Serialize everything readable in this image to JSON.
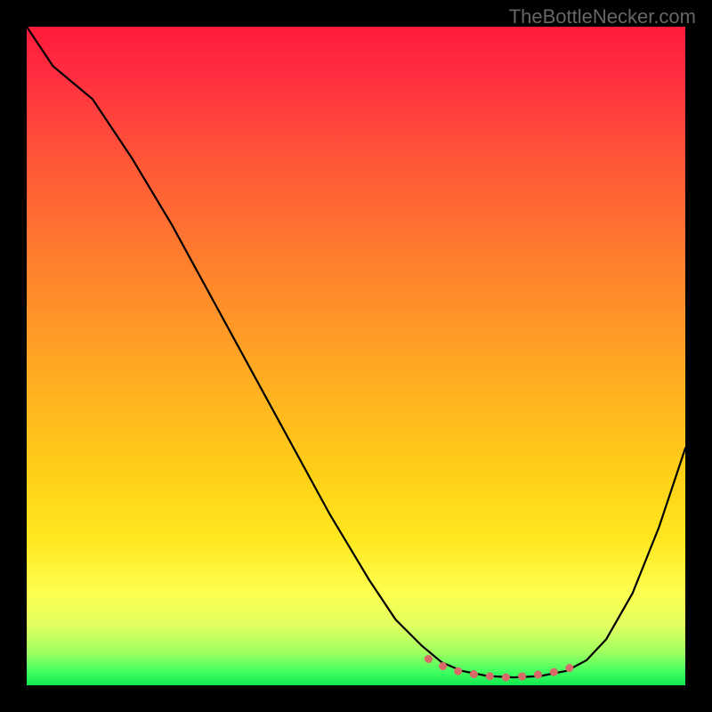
{
  "watermark": "TheBottleNecker.com",
  "colors": {
    "curve": "#000000",
    "dots": "#d86a6a",
    "background": "#000000"
  },
  "chart_data": {
    "type": "line",
    "title": "",
    "xlabel": "",
    "ylabel": "",
    "xlim": [
      0,
      100
    ],
    "ylim": [
      0,
      100
    ],
    "note": "No axes or tick labels are rendered in the source image. x and y are normalized 0–100. y represents percent-from-top (0 = top, 100 = bottom). Curve shape estimated from pixel positions.",
    "series": [
      {
        "name": "bottleneck-curve",
        "x": [
          0,
          4,
          10,
          16,
          22,
          28,
          34,
          40,
          46,
          52,
          56,
          60,
          63,
          66,
          70,
          74,
          78,
          82,
          85,
          88,
          92,
          96,
          100
        ],
        "y": [
          0,
          6,
          11,
          20,
          30,
          41,
          52,
          63,
          74,
          84,
          90,
          94,
          96.5,
          97.8,
          98.6,
          98.8,
          98.6,
          97.8,
          96.2,
          93,
          86,
          76,
          64
        ]
      }
    ],
    "valley_marker": {
      "name": "valley-dots",
      "note": "Coral dotted overlay across the valley floor",
      "x": [
        61,
        64,
        67,
        70,
        73,
        76,
        79,
        82,
        84
      ],
      "y": [
        96.0,
        97.5,
        98.2,
        98.6,
        98.8,
        98.6,
        98.2,
        97.6,
        96.5
      ]
    }
  }
}
